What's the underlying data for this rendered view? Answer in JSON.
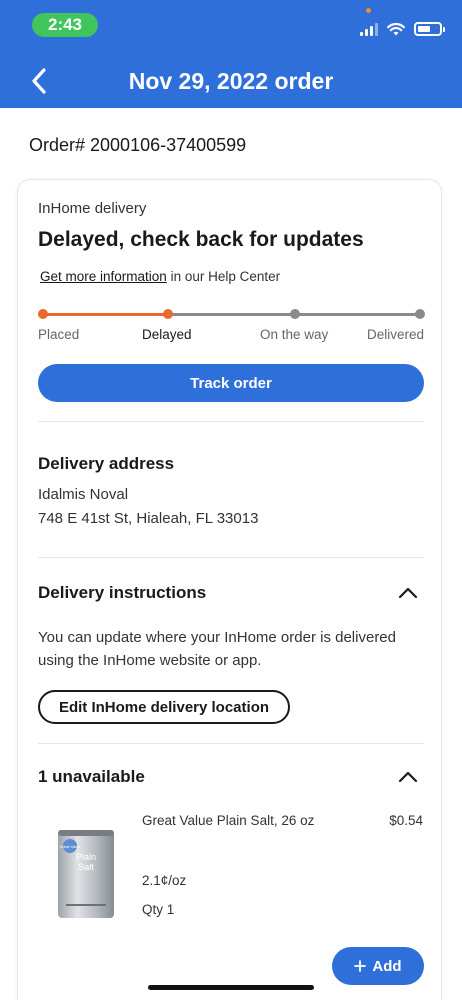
{
  "status_bar": {
    "time": "2:43"
  },
  "header": {
    "title": "Nov 29, 2022 order"
  },
  "order": {
    "number_text": "Order# 2000106-37400599"
  },
  "delivery_card": {
    "type_label": "InHome delivery",
    "status_title": "Delayed, check back for updates",
    "info_link": "Get more information",
    "info_suffix": " in our Help Center",
    "steps": [
      "Placed",
      "Delayed",
      "On the way",
      "Delivered"
    ],
    "current_step": 2,
    "track_button": "Track order"
  },
  "address": {
    "title": "Delivery address",
    "name": "Idalmis Noval",
    "line": "748 E 41st St, Hialeah, FL 33013"
  },
  "instructions": {
    "title": "Delivery instructions",
    "text_line1": "You can update where your InHome order is delivered",
    "text_line2": "using the InHome website or app.",
    "edit_button": "Edit InHome delivery location"
  },
  "unavailable": {
    "title": "1 unavailable",
    "items": [
      {
        "name": "Great Value Plain Salt, 26 oz",
        "price": "$0.54",
        "unit_price": "2.1¢/oz",
        "qty": "Qty 1",
        "add_button": "Add",
        "image_text": {
          "brand": "Great Value",
          "title_1": "Plain",
          "title_2": "Salt"
        }
      }
    ]
  },
  "colors": {
    "primary": "#2e6fd9",
    "status_green": "#3fc55c",
    "progress_active": "#e8692b",
    "progress_inactive": "#8a8a8a"
  }
}
